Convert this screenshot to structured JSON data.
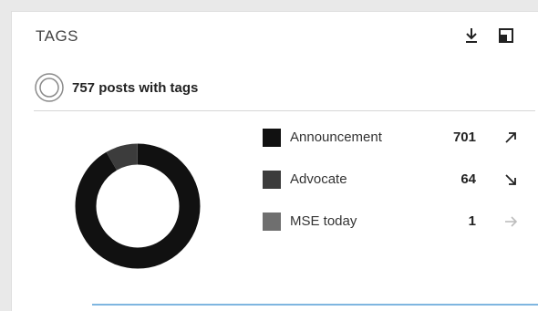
{
  "widget": {
    "title": "TAGS",
    "summary_text": "757 posts with tags",
    "download_icon": "download-icon",
    "popout_icon": "popout-icon"
  },
  "legend": [
    {
      "label": "Announcement",
      "value": "701",
      "color": "#111111",
      "trend": "up"
    },
    {
      "label": "Advocate",
      "value": "64",
      "color": "#3c3c3c",
      "trend": "down"
    },
    {
      "label": "MSE today",
      "value": "1",
      "color": "#6f6f6f",
      "trend": "flat"
    }
  ],
  "chart_data": {
    "type": "pie",
    "style": "donut",
    "categories": [
      "Announcement",
      "Advocate",
      "MSE today"
    ],
    "values": [
      701,
      64,
      1
    ],
    "colors": [
      "#111111",
      "#3c3c3c",
      "#6f6f6f"
    ]
  }
}
